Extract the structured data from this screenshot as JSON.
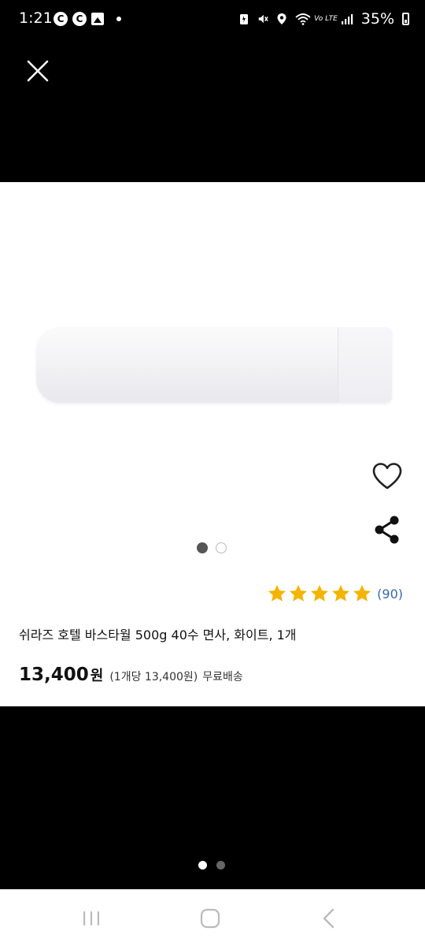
{
  "status_bar": {
    "time": "1:21",
    "left_icons": [
      "c-icon",
      "c-icon",
      "image-icon",
      "dot-icon"
    ],
    "left_icon_glyphs": [
      "C",
      "C"
    ],
    "right_icons": [
      "battery-saver-icon",
      "mute-icon",
      "location-icon",
      "wifi-icon",
      "signal-icon"
    ],
    "network_label": "Vo LTE",
    "battery": "35%"
  },
  "product": {
    "image_pages": 2,
    "image_active_index": 0,
    "rating_stars": 5,
    "rating_color": "#f5b400",
    "review_count": "(90)",
    "title": "쉬라즈 호텔 바스타월 500g 40수 면사, 화이트, 1개",
    "price": "13,400",
    "price_unit": "원",
    "unit_price": "(1개당 13,400원)",
    "shipping": "무료배송"
  },
  "viewer": {
    "page_dots": 2,
    "active_page": 0
  },
  "nav": {
    "buttons": [
      "recent-apps-icon",
      "home-icon",
      "back-icon"
    ]
  }
}
